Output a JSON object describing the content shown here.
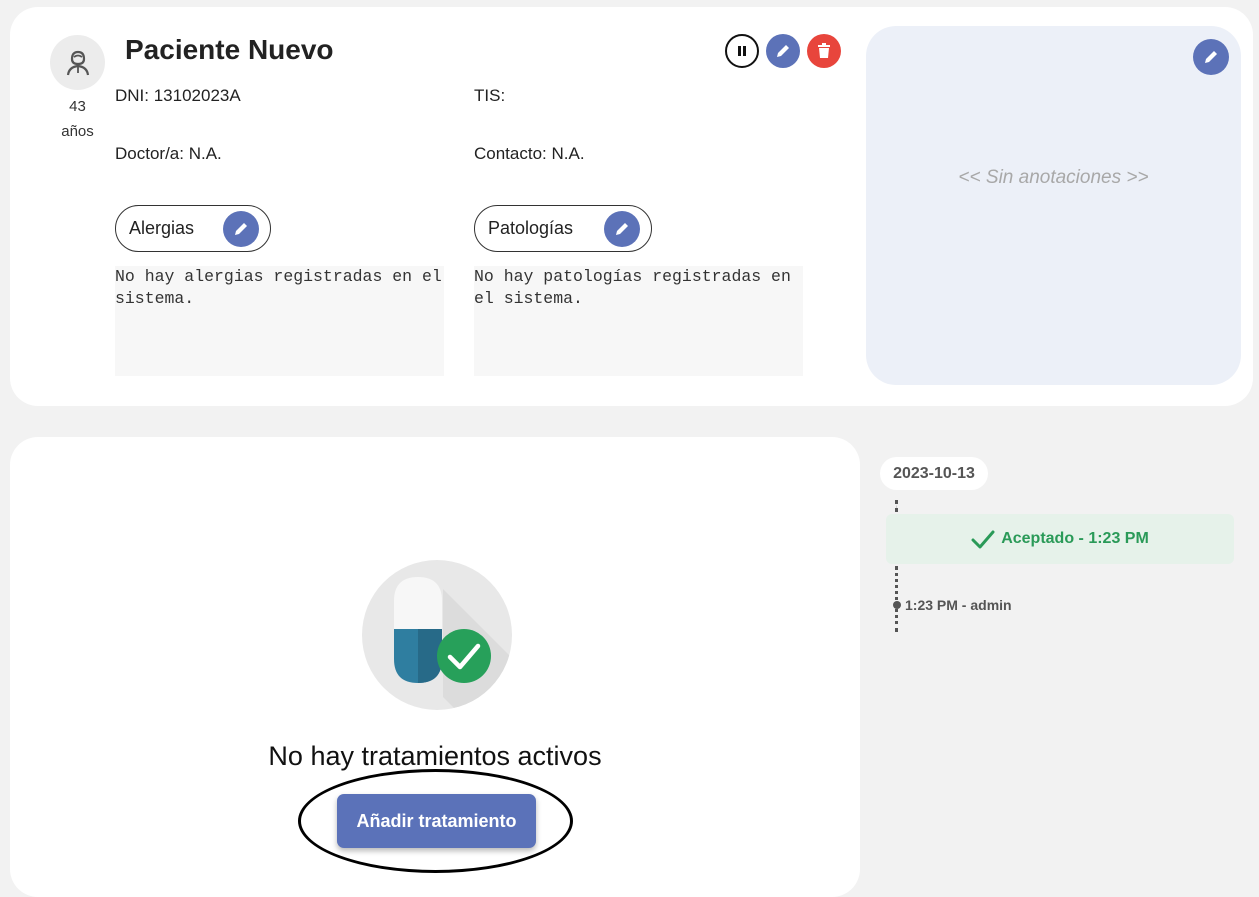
{
  "patient": {
    "name": "Paciente Nuevo",
    "age_number": "43",
    "age_unit": "años",
    "dni": "DNI: 13102023A",
    "tis": "TIS:",
    "doctor": "Doctor/a: N.A.",
    "contact": "Contacto: N.A."
  },
  "sections": {
    "allergies_label": "Alergias",
    "allergies_text": "No hay alergias registradas en el sistema.",
    "pathologies_label": "Patologías",
    "pathologies_text": "No hay patologías registradas en el sistema."
  },
  "annotations": {
    "empty_text": "<< Sin anotaciones >>"
  },
  "treatments": {
    "empty_text": "No hay tratamientos activos",
    "add_button": "Añadir tratamiento"
  },
  "timeline": {
    "date": "2023-10-13",
    "status": "Aceptado - 1:23 PM",
    "log": "1:23 PM - admin"
  },
  "icons": {
    "avatar": "user-avatar-icon",
    "pause": "pause-icon",
    "edit": "pencil-icon",
    "delete": "trash-icon",
    "status": "check-icon",
    "empty": "pill-check-icon"
  },
  "colors": {
    "primary": "#5c72b8",
    "danger": "#e8453c",
    "success": "#2a9a58",
    "annotation_bg": "#ecf0f8"
  }
}
